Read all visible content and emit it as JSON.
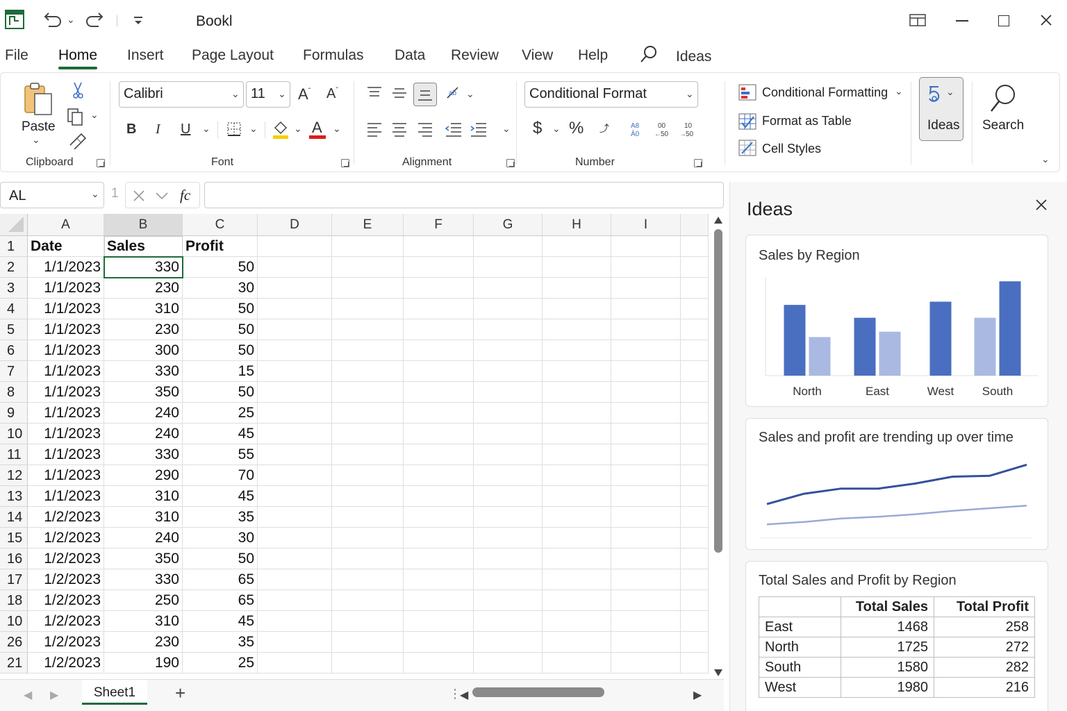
{
  "app": {
    "title": "Bookl"
  },
  "tabs": [
    "File",
    "Home",
    "Insert",
    "Page Layout",
    "Formulas",
    "Data",
    "Review",
    "View",
    "Help",
    "Ideas"
  ],
  "ribbon": {
    "clipboard": {
      "paste_label": "Paste",
      "group_label": "Clipboard"
    },
    "font": {
      "name": "Calibri",
      "size": "11",
      "group_label": "Font",
      "bold": "B",
      "italic": "I",
      "underline": "U",
      "grow": "A",
      "shrink": "A",
      "font_color": "A"
    },
    "alignment": {
      "group_label": "Alignment"
    },
    "number": {
      "format": "Conditional Format",
      "group_label": "Number",
      "currency": "$",
      "percent": "%"
    },
    "styles": {
      "conditional_formatting": "Conditional Formatting",
      "format_as_table": "Format as Table",
      "cell_styles": "Cell Styles"
    },
    "ideas_label": "Ideas",
    "search_label": "Search"
  },
  "formula_bar": {
    "name_box": "AL",
    "row_hint": "1",
    "fx": "fc",
    "value": ""
  },
  "sheet": {
    "columns": [
      "A",
      "B",
      "C",
      "D",
      "E",
      "F",
      "G",
      "H",
      "I"
    ],
    "row_numbers": [
      "1",
      "2",
      "3",
      "4",
      "5",
      "6",
      "7",
      "8",
      "9",
      "10",
      "11",
      "12",
      "13",
      "14",
      "15",
      "16",
      "17",
      "18",
      "10",
      "26",
      "21"
    ],
    "headers": [
      "Date",
      "Sales",
      "Profit"
    ],
    "rows": [
      [
        "1/1/2023",
        "330",
        "50"
      ],
      [
        "1/1/2023",
        "230",
        "30"
      ],
      [
        "1/1/2023",
        "310",
        "50"
      ],
      [
        "1/1/2023",
        "230",
        "50"
      ],
      [
        "1/1/2023",
        "300",
        "50"
      ],
      [
        "1/1/2023",
        "330",
        "15"
      ],
      [
        "1/1/2023",
        "350",
        "50"
      ],
      [
        "1/1/2023",
        "240",
        "25"
      ],
      [
        "1/1/2023",
        "240",
        "45"
      ],
      [
        "1/1/2023",
        "330",
        "55"
      ],
      [
        "1/1/2023",
        "290",
        "70"
      ],
      [
        "1/1/2023",
        "310",
        "45"
      ],
      [
        "1/2/2023",
        "310",
        "35"
      ],
      [
        "1/2/2023",
        "240",
        "30"
      ],
      [
        "1/2/2023",
        "350",
        "50"
      ],
      [
        "1/2/2023",
        "330",
        "65"
      ],
      [
        "1/2/2023",
        "250",
        "65"
      ],
      [
        "1/2/2023",
        "310",
        "45"
      ],
      [
        "1/2/2023",
        "230",
        "35"
      ],
      [
        "1/2/2023",
        "190",
        "25"
      ]
    ],
    "tab_name": "Sheet1",
    "add_sheet": "+"
  },
  "ideas_panel": {
    "title": "Ideas",
    "card1": {
      "title": "Sales by Region"
    },
    "card2": {
      "title": "Sales and profit are trending up over time"
    },
    "card3": {
      "title": "Total Sales and Profit by Region",
      "headers": [
        "",
        "Total Sales",
        "Total Profit"
      ],
      "rows": [
        [
          "East",
          "1468",
          "258"
        ],
        [
          "North",
          "1725",
          "272"
        ],
        [
          "South",
          "1580",
          "282"
        ],
        [
          "West",
          "1980",
          "216"
        ]
      ]
    }
  },
  "chart_data": [
    {
      "type": "bar",
      "title": "Sales by Region",
      "categories": [
        "North",
        "East",
        "West",
        "South"
      ],
      "series": [
        {
          "values": [
            330,
            270,
            345,
            440
          ],
          "color": "#4a6fc0"
        },
        {
          "values": [
            180,
            205,
            null,
            270
          ],
          "color": "#a9b9e2"
        }
      ],
      "ylim": [
        0,
        460
      ],
      "grid": false
    },
    {
      "type": "line",
      "title": "Sales and profit are trending up over time",
      "x": [
        1,
        2,
        3,
        4,
        5,
        6,
        7,
        8
      ],
      "series": [
        {
          "values": [
            40,
            52,
            58,
            58,
            64,
            72,
            73,
            86
          ],
          "color": "#34509e"
        },
        {
          "values": [
            16,
            19,
            23,
            25,
            28,
            32,
            35,
            38
          ],
          "color": "#9aaad6"
        }
      ],
      "ylim": [
        0,
        100
      ],
      "grid": false
    }
  ]
}
